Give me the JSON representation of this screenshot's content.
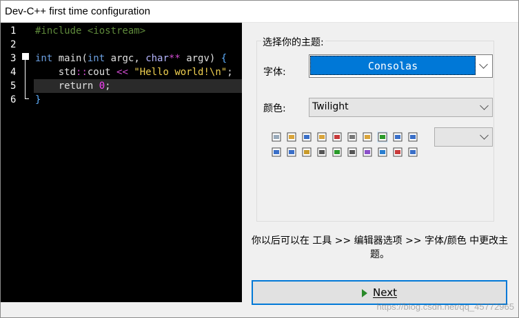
{
  "window": {
    "title": "Dev-C++ first time configuration"
  },
  "editor": {
    "line_numbers": [
      "1",
      "2",
      "3",
      "4",
      "5",
      "6"
    ],
    "lines": [
      {
        "tokens": [
          {
            "t": "#include <iostream>",
            "c": "comment"
          }
        ]
      },
      {
        "tokens": []
      },
      {
        "tokens": [
          {
            "t": "int",
            "c": "kw"
          },
          {
            "t": " main(",
            "c": "id"
          },
          {
            "t": "int",
            "c": "kw"
          },
          {
            "t": " argc, ",
            "c": "id"
          },
          {
            "t": "char",
            "c": "type"
          },
          {
            "t": "**",
            "c": "op"
          },
          {
            "t": " argv) ",
            "c": "id"
          },
          {
            "t": "{",
            "c": "brace"
          }
        ]
      },
      {
        "tokens": [
          {
            "t": "    std",
            "c": "id"
          },
          {
            "t": "::",
            "c": "ns"
          },
          {
            "t": "cout ",
            "c": "id"
          },
          {
            "t": "<<",
            "c": "op"
          },
          {
            "t": " ",
            "c": "id"
          },
          {
            "t": "\"Hello world!\\n\"",
            "c": "str"
          },
          {
            "t": ";",
            "c": "id"
          }
        ]
      },
      {
        "tokens": [
          {
            "t": "    return ",
            "c": "id"
          },
          {
            "t": "0",
            "c": "num"
          },
          {
            "t": ";",
            "c": "id"
          }
        ]
      },
      {
        "tokens": [
          {
            "t": "}",
            "c": "brace"
          }
        ]
      }
    ]
  },
  "theme": {
    "group_title": "选择你的主题:",
    "font_label": "字体:",
    "font_value": "Consolas",
    "color_label": "颜色:",
    "color_value": "Twilight",
    "small_select_value": ""
  },
  "toolbar": {
    "icons": [
      "new-file-icon",
      "open-file-icon",
      "save-icon",
      "save-all-icon",
      "close-icon",
      "print-icon",
      "undo-icon",
      "redo-icon",
      "find-icon",
      "replace-icon",
      "compile-icon",
      "run-icon",
      "grid-icon",
      "window-icon",
      "color-grid-icon",
      "apps-icon",
      "check-icon",
      "chart-icon",
      "debug-icon",
      "profile-icon"
    ]
  },
  "info_text": "你以后可以在 工具 >> 编辑器选项 >> 字体/颜色 中更改主题。",
  "next_button": {
    "label": "Next"
  },
  "watermark": "https://blog.csdn.net/qq_45772965"
}
